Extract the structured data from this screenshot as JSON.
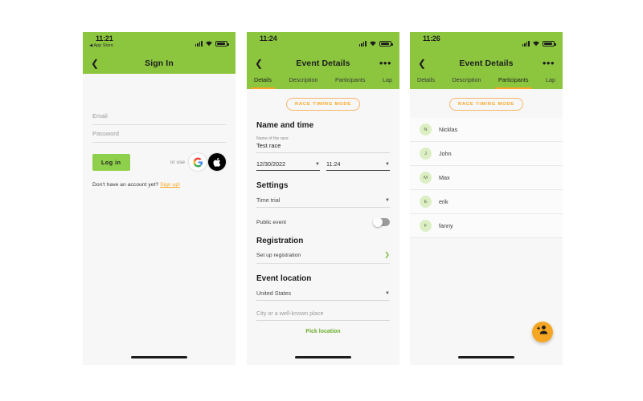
{
  "screens": [
    {
      "id": "sign-in",
      "status": {
        "time": "11:21",
        "back_app": "◀ App Store",
        "signal_icon": "signal-bars-icon",
        "wifi_icon": "wifi-icon",
        "battery_icon": "battery-icon"
      },
      "nav": {
        "back_icon": "chevron-left-icon",
        "title": "Sign In"
      },
      "form": {
        "email_placeholder": "Email",
        "password_placeholder": "Password",
        "login_label": "Log in",
        "or_use": "or use",
        "google_icon": "google-icon",
        "apple_icon": "apple-icon",
        "signup_prompt": "Don't have an account yet?",
        "signup_link": "Sign up!"
      }
    },
    {
      "id": "event-details",
      "status": {
        "time": "11:24",
        "signal_icon": "signal-bars-icon",
        "wifi_icon": "wifi-icon",
        "battery_icon": "battery-icon"
      },
      "nav": {
        "back_icon": "chevron-left-icon",
        "title": "Event Details",
        "more_icon": "more-horizontal-icon",
        "more_label": "•••"
      },
      "tabs": [
        {
          "label": "Details",
          "active": true
        },
        {
          "label": "Description",
          "active": false
        },
        {
          "label": "Participants",
          "active": false
        },
        {
          "label": "Lap",
          "active": false
        }
      ],
      "badge": "RACE TIMING MODE",
      "sections": {
        "name_time": {
          "title": "Name and time",
          "race_name_label": "Name of the race",
          "race_name_value": "Test race",
          "date_value": "12/30/2022",
          "time_value": "11:24"
        },
        "settings": {
          "title": "Settings",
          "mode_value": "Time trial",
          "public_event_label": "Public event",
          "public_event_on": false
        },
        "registration": {
          "title": "Registration",
          "setup_label": "Set up registration",
          "chevron_icon": "chevron-right-icon"
        },
        "location": {
          "title": "Event location",
          "country_value": "United States",
          "city_placeholder": "City or a well-known place",
          "pick_location_label": "Pick location"
        }
      }
    },
    {
      "id": "participants",
      "status": {
        "time": "11:26",
        "signal_icon": "signal-bars-icon",
        "wifi_icon": "wifi-icon",
        "battery_icon": "battery-icon"
      },
      "nav": {
        "back_icon": "chevron-left-icon",
        "title": "Event Details",
        "more_label": "•••"
      },
      "tabs": [
        {
          "label": "Details",
          "active": false
        },
        {
          "label": "Description",
          "active": false
        },
        {
          "label": "Participants",
          "active": true
        },
        {
          "label": "Lap",
          "active": false
        }
      ],
      "badge": "RACE TIMING MODE",
      "participants": [
        {
          "initial": "N",
          "name": "Nicklas"
        },
        {
          "initial": "J",
          "name": "John"
        },
        {
          "initial": "M",
          "name": "Max"
        },
        {
          "initial": "E",
          "name": "erik"
        },
        {
          "initial": "F",
          "name": "fanny"
        }
      ],
      "fab_icon": "add-person-icon"
    }
  ],
  "colors": {
    "green_header": "#8cc63f",
    "accent_orange": "#f5a623",
    "login_green": "#8ed04b",
    "avatar_green": "#dcefc4",
    "link_green": "#6fae2f"
  }
}
